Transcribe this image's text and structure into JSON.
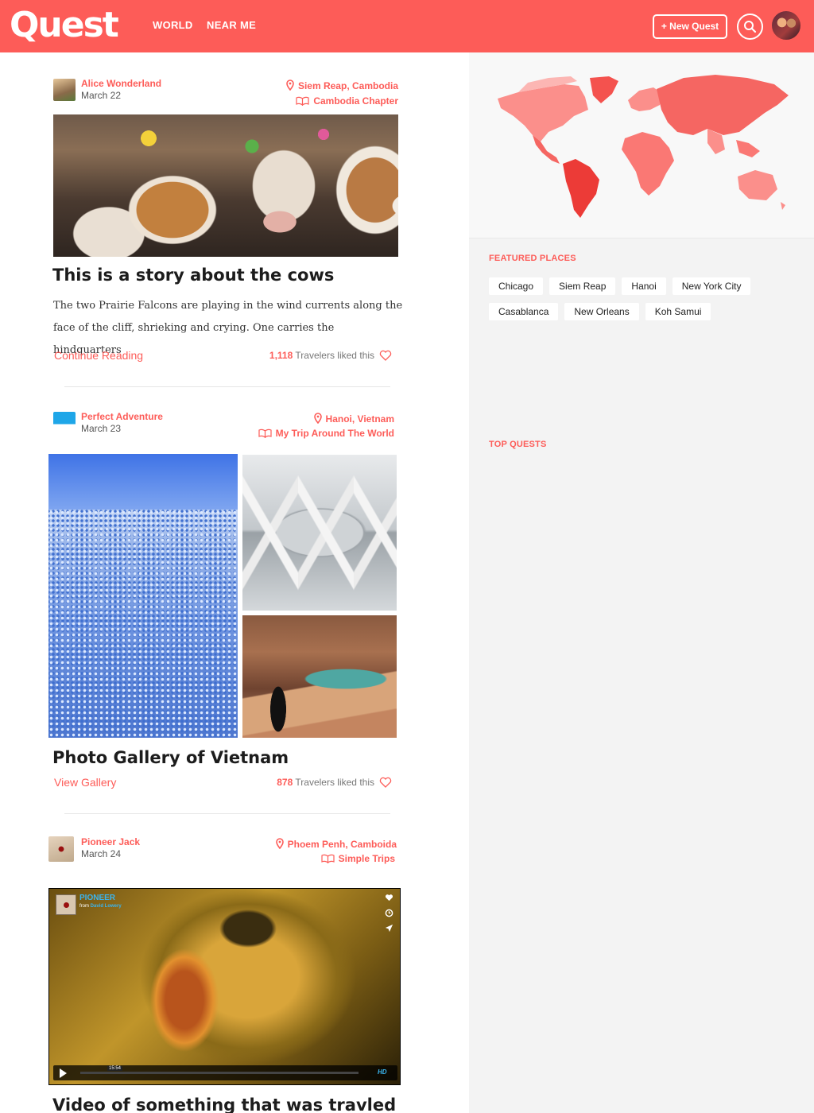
{
  "header": {
    "logo": "Quest",
    "nav": [
      "WORLD",
      "NEAR ME"
    ],
    "new_quest": "+ New Quest",
    "colors": {
      "brand": "#fd5c58"
    }
  },
  "posts": [
    {
      "author": "Alice Wonderland",
      "date": "March 22",
      "location": "Siem Reap, Cambodia",
      "collection": "Cambodia Chapter",
      "title": "This is a story about the cows",
      "excerpt": "The two Prairie Falcons are playing in the wind currents along the face of the cliff, shrieking and crying. One carries the hindquarters",
      "action": "Continue Reading",
      "likes_count": "1,118",
      "likes_text": "Travelers liked this"
    },
    {
      "author": "Perfect Adventure",
      "date": "March 23",
      "location": "Hanoi, Vietnam",
      "collection": "My Trip Around The World",
      "title": "Photo Gallery of Vietnam",
      "action": "View Gallery",
      "likes_count": "878",
      "likes_text": "Travelers liked this"
    },
    {
      "author": "Pioneer Jack",
      "date": "March 24",
      "location": "Phoem Penh, Camboida",
      "collection": "Simple Trips",
      "title": "Video of something that was travled",
      "video": {
        "title": "PIONEER",
        "from": "from",
        "by": "David Lowery",
        "time": "15:54",
        "quality": "HD"
      }
    }
  ],
  "sidebar": {
    "featured_title": "FEATURED PLACES",
    "places": [
      "Chicago",
      "Siem Reap",
      "Hanoi",
      "New York City",
      "Casablanca",
      "New Orleans",
      "Koh Samui"
    ],
    "top_title": "TOP QUESTS"
  },
  "icons": [
    "search-icon",
    "pin-icon",
    "book-icon",
    "heart-icon",
    "play-icon",
    "clock-icon",
    "send-icon"
  ]
}
